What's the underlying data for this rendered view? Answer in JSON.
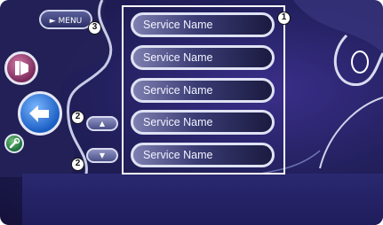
{
  "menu_button": {
    "label": "MENU",
    "arrow": "►"
  },
  "service_list": {
    "items": [
      {
        "label": "Service Name"
      },
      {
        "label": "Service Name"
      },
      {
        "label": "Service Name"
      },
      {
        "label": "Service Name"
      },
      {
        "label": "Service Name"
      }
    ]
  },
  "scroll_buttons": {
    "up": "▲",
    "down": "▼"
  },
  "callouts": {
    "list": "1",
    "scroll_up": "2",
    "scroll_down": "2",
    "menu": "3"
  },
  "side_icons": [
    "media-source-icon",
    "back-arrow-icon",
    "wrench-icon"
  ],
  "colors": {
    "panel_bg": "#23205e",
    "button_border": "#dfe2f3",
    "accent_blue": "#1b5fc4"
  }
}
